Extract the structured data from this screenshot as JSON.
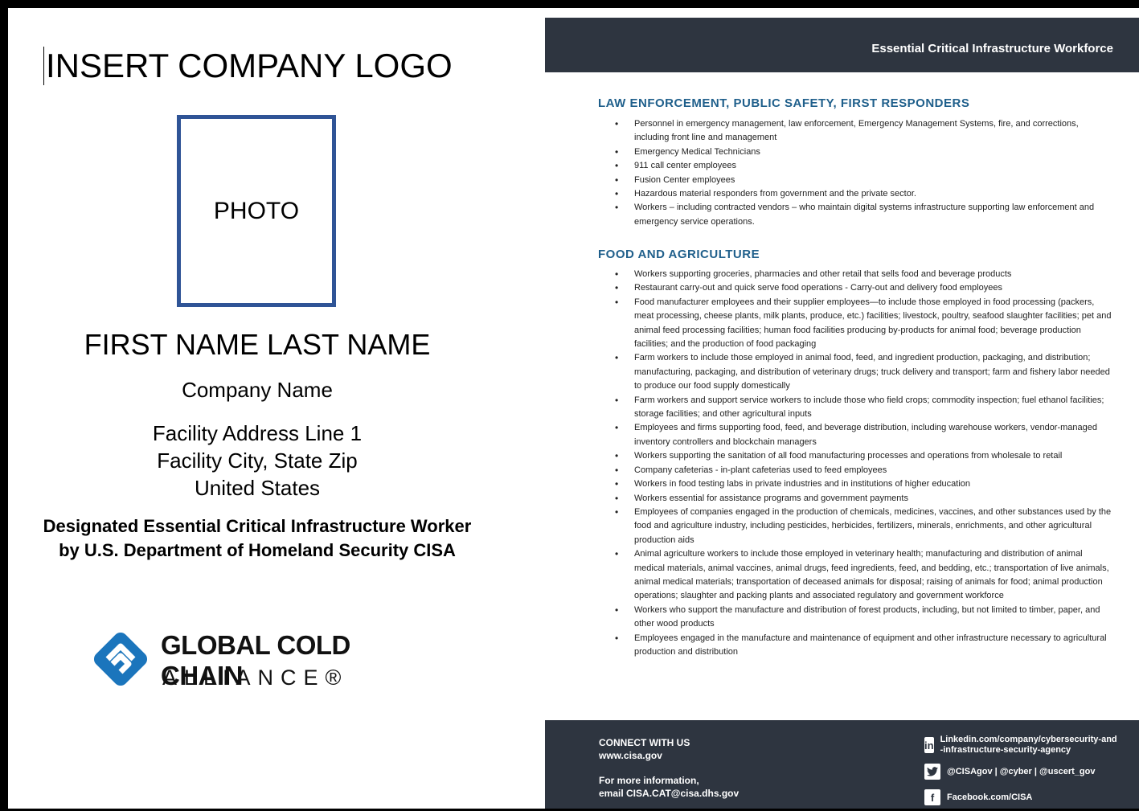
{
  "badge": {
    "logo_placeholder": "INSERT COMPANY LOGO",
    "photo_label": "PHOTO",
    "name": "FIRST NAME LAST NAME",
    "company": "Company Name",
    "address_line_1": "Facility Address Line 1",
    "address_line_2": "Facility City, State Zip",
    "country": "United States",
    "designation_line_1": "Designated Essential Critical Infrastructure Worker",
    "designation_line_2": "by U.S. Department of Homeland Security CISA",
    "gcca_title": "GLOBAL COLD CHAIN",
    "gcca_subtitle": "ALLIANCE®",
    "colors": {
      "photo_border": "#2f5496",
      "gcca_blue": "#1b75bc"
    }
  },
  "flyer": {
    "header_title": "Essential Critical Infrastructure Workforce",
    "sections": [
      {
        "title": "LAW ENFORCEMENT, PUBLIC SAFETY, FIRST RESPONDERS",
        "items": [
          "Personnel in emergency management, law enforcement, Emergency Management Systems, fire, and corrections, including front line and management",
          "Emergency Medical Technicians",
          "911 call center employees",
          "Fusion Center employees",
          "Hazardous material responders from government and the private sector.",
          "Workers – including contracted vendors – who maintain digital systems infrastructure supporting law enforcement and emergency service operations."
        ]
      },
      {
        "title": "FOOD AND AGRICULTURE",
        "items": [
          "Workers supporting groceries, pharmacies and other retail that sells food and beverage products",
          "Restaurant carry-out and quick serve food operations - Carry-out and delivery food employees",
          "Food manufacturer employees and their supplier employees—to include those employed in food processing (packers, meat processing, cheese plants, milk plants, produce, etc.) facilities; livestock, poultry, seafood slaughter facilities; pet and animal feed processing facilities; human food facilities producing by-products for animal food; beverage production facilities; and the production of food packaging",
          "Farm workers to include those employed in animal food, feed, and ingredient production, packaging, and distribution; manufacturing, packaging, and distribution of veterinary drugs; truck delivery and transport; farm and fishery labor needed to produce our food supply domestically",
          "Farm workers and support service workers to include those who field crops; commodity inspection; fuel ethanol facilities; storage facilities; and other agricultural inputs",
          "Employees and firms supporting food, feed, and beverage distribution, including warehouse workers, vendor-managed inventory controllers and blockchain managers",
          "Workers supporting the sanitation of all food manufacturing processes and operations from wholesale to retail",
          "Company cafeterias - in-plant cafeterias used to feed employees",
          "Workers in food testing labs in private industries and in institutions of higher education",
          "Workers essential for assistance programs and government payments",
          "Employees of companies engaged in the production of chemicals, medicines, vaccines, and other substances used by the food and agriculture industry, including pesticides, herbicides, fertilizers, minerals, enrichments, and other agricultural production aids",
          "Animal agriculture workers to include those employed in veterinary health; manufacturing and distribution of animal medical materials, animal vaccines, animal drugs, feed ingredients, feed, and bedding, etc.; transportation of live animals, animal medical materials; transportation of deceased animals for disposal; raising of animals for food; animal production operations; slaughter and packing plants and associated regulatory and government workforce",
          "Workers who support the manufacture and distribution of forest products, including, but not limited to timber, paper, and other wood products",
          "Employees engaged in the manufacture and maintenance of equipment and other infrastructure necessary to agricultural production and distribution"
        ]
      }
    ],
    "footer": {
      "connect_title": "CONNECT WITH US",
      "connect_url": "www.cisa.gov",
      "info_title": "For more information,",
      "info_email": "email CISA.CAT@cisa.dhs.gov",
      "linkedin": "Linkedin.com/company/cybersecurity-and-infrastructure-security-agency",
      "twitter": "@CISAgov | @cyber | @uscert_gov",
      "facebook": "Facebook.com/CISA"
    },
    "colors": {
      "header_bg": "#2e3540",
      "section_title": "#1f5f8b"
    }
  }
}
